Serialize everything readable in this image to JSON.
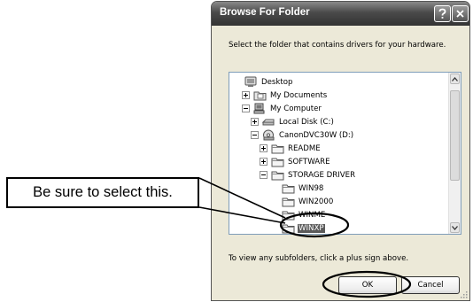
{
  "dialog": {
    "title": "Browse For Folder",
    "instruction": "Select the folder that contains drivers for your hardware.",
    "hint": "To view any subfolders, click a plus sign above.",
    "ok_label": "OK",
    "cancel_label": "Cancel"
  },
  "tree": {
    "items": [
      {
        "label": "Desktop",
        "icon": "desktop-icon",
        "expander": "none",
        "selected": false
      },
      {
        "label": "My Documents",
        "icon": "documents-folder-icon",
        "expander": "plus",
        "selected": false
      },
      {
        "label": "My Computer",
        "icon": "computer-icon",
        "expander": "minus",
        "selected": false
      },
      {
        "label": "Local Disk (C:)",
        "icon": "hard-disk-icon",
        "expander": "plus",
        "selected": false
      },
      {
        "label": "CanonDVC30W (D:)",
        "icon": "cd-drive-icon",
        "expander": "minus",
        "selected": false
      },
      {
        "label": "README",
        "icon": "folder-icon",
        "expander": "plus",
        "selected": false
      },
      {
        "label": "SOFTWARE",
        "icon": "folder-icon",
        "expander": "plus",
        "selected": false
      },
      {
        "label": "STORAGE DRIVER",
        "icon": "folder-icon",
        "expander": "minus",
        "selected": false
      },
      {
        "label": "WIN98",
        "icon": "folder-icon",
        "expander": "none",
        "selected": false
      },
      {
        "label": "WIN2000",
        "icon": "folder-icon",
        "expander": "none",
        "selected": false
      },
      {
        "label": "WINME",
        "icon": "folder-icon",
        "expander": "none",
        "selected": false
      },
      {
        "label": "WINXP",
        "icon": "folder-icon",
        "expander": "none",
        "selected": true
      }
    ]
  },
  "annotation": {
    "callout_text": "Be sure to select this."
  },
  "colors": {
    "titlebar": "#4a4a4a",
    "dialog_bg": "#ece9d8",
    "selection": "#5a5a5a"
  }
}
